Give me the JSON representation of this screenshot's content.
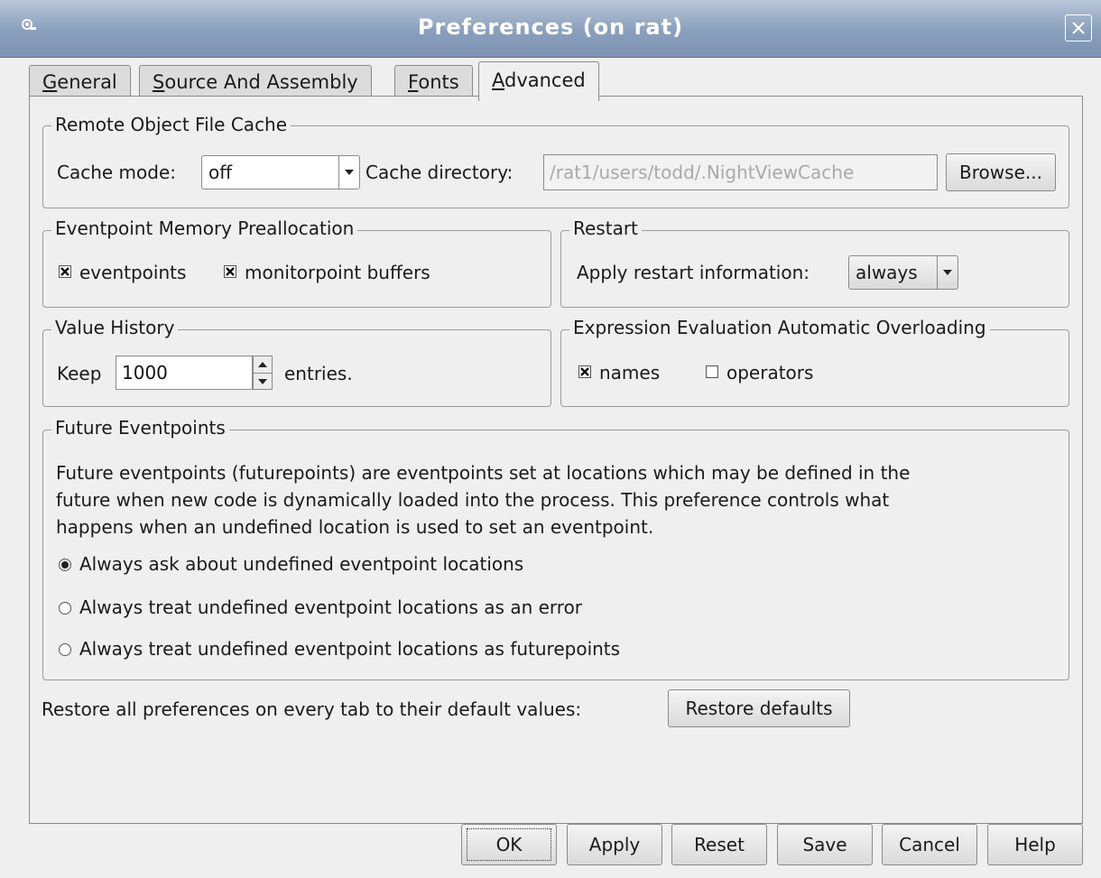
{
  "window": {
    "title": "Preferences (on rat)"
  },
  "tabs": [
    {
      "pre": "",
      "key": "G",
      "post": "eneral"
    },
    {
      "pre": "",
      "key": "S",
      "post": "ource And Assembly"
    },
    {
      "pre": "",
      "key": "F",
      "post": "onts"
    },
    {
      "pre": "",
      "key": "A",
      "post": "dvanced"
    }
  ],
  "cache": {
    "legend": "Remote Object File Cache",
    "mode_label": "Cache mode:",
    "mode_value": "off",
    "dir_label": "Cache directory:",
    "dir_value": "/rat1/users/todd/.NightViewCache",
    "browse_label": "Browse..."
  },
  "eventpoint_memory": {
    "legend": "Eventpoint Memory Preallocation",
    "eventpoints_label": "eventpoints",
    "eventpoints_checked": true,
    "monitor_label": "monitorpoint buffers",
    "monitor_checked": true
  },
  "restart": {
    "legend": "Restart",
    "label": "Apply restart information:",
    "value": "always"
  },
  "value_history": {
    "legend": "Value History",
    "keep_label": "Keep",
    "keep_value": "1000",
    "entries_label": "entries."
  },
  "overloading": {
    "legend": "Expression Evaluation Automatic Overloading",
    "names_label": "names",
    "names_checked": true,
    "operators_label": "operators",
    "operators_checked": false
  },
  "future": {
    "legend": "Future Eventpoints",
    "desc_line1": "Future eventpoints (futurepoints) are eventpoints set at locations which may be defined in the",
    "desc_line2": "future when new code is dynamically loaded into the process. This preference controls what",
    "desc_line3": "happens when an undefined location is used to set an eventpoint.",
    "options": [
      "Always ask about undefined eventpoint locations",
      "Always treat undefined eventpoint locations as an error",
      "Always treat undefined eventpoint locations as futurepoints"
    ],
    "selected_index": 0
  },
  "restore": {
    "label": "Restore all preferences on every tab to their default values:",
    "button": "Restore defaults"
  },
  "buttons": {
    "ok": "OK",
    "apply": "Apply",
    "reset": "Reset",
    "save": "Save",
    "cancel": "Cancel",
    "help": "Help"
  }
}
